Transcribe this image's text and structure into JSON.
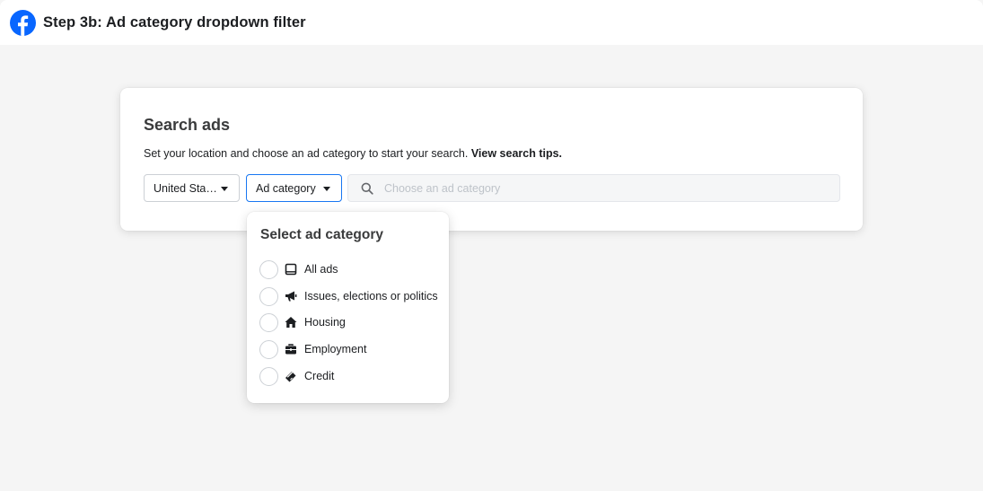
{
  "header": {
    "title": "Step 3b: Ad category dropdown filter",
    "logo_icon": "facebook-logo-icon",
    "brand_color": "#0866ff"
  },
  "search_card": {
    "title": "Search ads",
    "subtitle": "Set your location and choose an ad category to start your search.",
    "tips_link": "View search tips.",
    "country_select": {
      "value": "United Sta…"
    },
    "category_select": {
      "value": "Ad category",
      "active_border_color": "#1877f2"
    },
    "search_input": {
      "placeholder": "Choose an ad category",
      "value": ""
    }
  },
  "dropdown": {
    "title": "Select ad category",
    "options": [
      {
        "label": "All ads",
        "icon": "tablet-icon",
        "selected": false
      },
      {
        "label": "Issues, elections or politics",
        "icon": "megaphone-icon",
        "selected": false
      },
      {
        "label": "Housing",
        "icon": "house-icon",
        "selected": false
      },
      {
        "label": "Employment",
        "icon": "briefcase-icon",
        "selected": false
      },
      {
        "label": "Credit",
        "icon": "card-icon",
        "selected": false
      }
    ]
  }
}
